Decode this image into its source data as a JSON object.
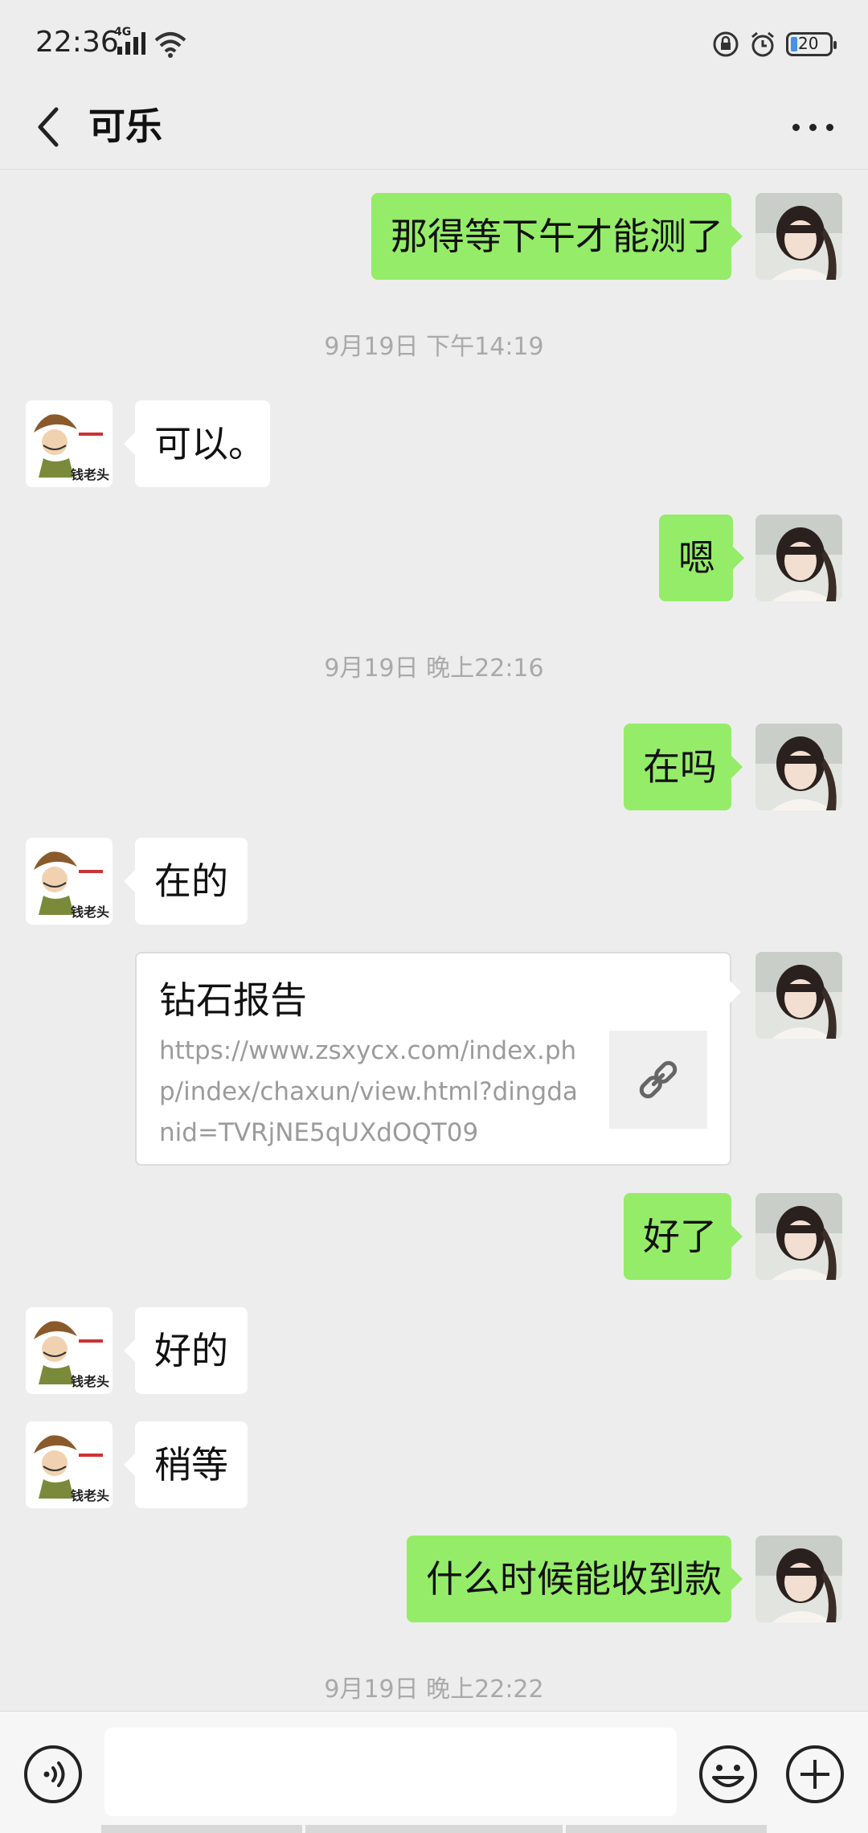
{
  "status": {
    "time": "22:36",
    "network": "4G",
    "battery": "20"
  },
  "header": {
    "title": "可乐"
  },
  "messages": [
    {
      "side": "self",
      "text": "那得等下午才能测了"
    },
    {
      "timestamp": "9月19日 下午14:19"
    },
    {
      "side": "other",
      "text": "可以。"
    },
    {
      "side": "self",
      "text": "嗯"
    },
    {
      "timestamp": "9月19日 晚上22:16"
    },
    {
      "side": "self",
      "text": "在吗"
    },
    {
      "side": "other",
      "text": "在的"
    },
    {
      "side": "self",
      "type": "link",
      "title": "钻石报告",
      "url": "https://www.zsxycx.com/index.php/index/chaxun/view.html?dingdanid=TVRjNE5qUXdOQT09"
    },
    {
      "side": "self",
      "text": "好了"
    },
    {
      "side": "other",
      "text": "好的"
    },
    {
      "side": "other",
      "text": "稍等"
    },
    {
      "side": "self",
      "text": "什么时候能收到款"
    },
    {
      "timestamp": "9月19日 晚上22:22"
    }
  ],
  "avatars": {
    "other_caption": "钱老头"
  },
  "input": {
    "placeholder": ""
  },
  "colors": {
    "self_bubble": "#95ec69",
    "other_bubble": "#ffffff",
    "background": "#ededed"
  }
}
